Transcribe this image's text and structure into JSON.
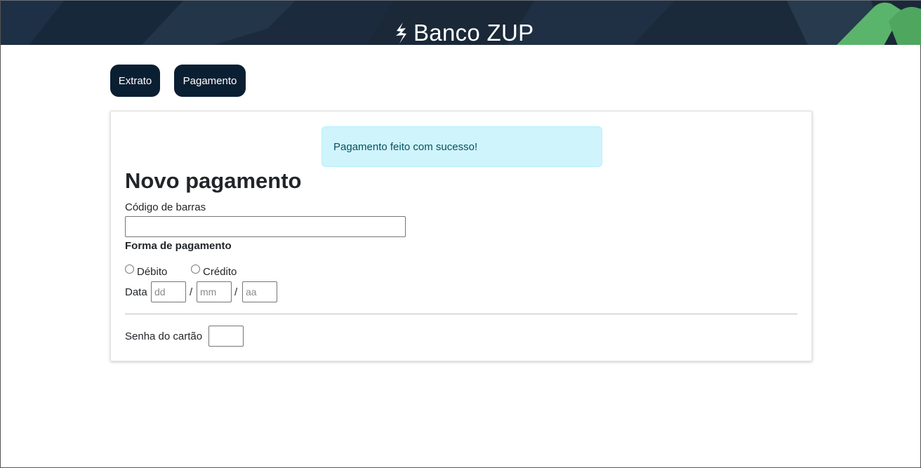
{
  "header": {
    "title": "Banco ZUP",
    "logo_icon": "lightning-bolt-icon"
  },
  "nav": {
    "extrato_label": "Extrato",
    "pagamento_label": "Pagamento"
  },
  "alert": {
    "message": "Pagamento feito com sucesso!"
  },
  "form": {
    "title": "Novo pagamento",
    "codigo_label": "Código de barras",
    "codigo_value": "",
    "forma_label": "Forma de pagamento",
    "options": [
      "Débito",
      "Crédito"
    ],
    "data_label": "Data",
    "date_placeholders": {
      "day": "dd",
      "month": "mm",
      "year": "aa"
    },
    "separator": "/",
    "senha_label": "Senha do cartão",
    "senha_value": ""
  },
  "colors": {
    "header_bg": "#1a2838",
    "nav_button_bg": "#0b1f33",
    "alert_bg": "#cff4fc",
    "alert_text": "#055160",
    "accent_green": "#5bb46c"
  }
}
